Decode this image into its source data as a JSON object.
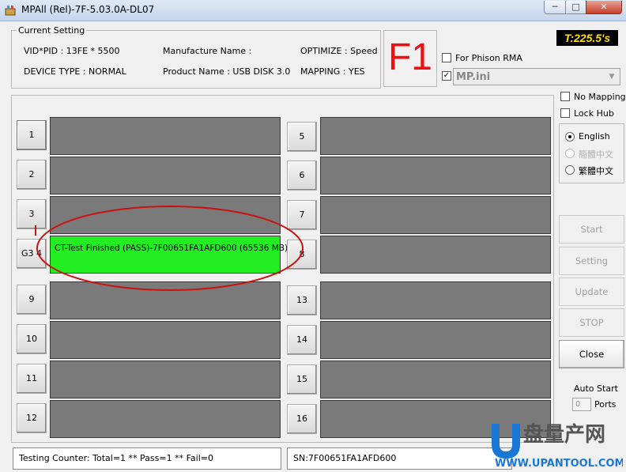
{
  "window": {
    "title": "MPAll (Rel)-7F-5.03.0A-DL07",
    "min_glyph": "─",
    "max_glyph": "□",
    "close_glyph": "✕"
  },
  "current_setting": {
    "legend": "Current Setting",
    "vid_pid": "VID*PID : 13FE * 5500",
    "manufacture_name": "Manufacture Name :",
    "optimize": "OPTIMIZE : Speed",
    "device_type": "DEVICE TYPE : NORMAL",
    "product_name": "Product Name : USB DISK 3.0",
    "mapping": "MAPPING : YES"
  },
  "f1_label": "F1",
  "timer": "T:225.5's",
  "for_phison_rma": {
    "label": "For Phison RMA",
    "checked": false
  },
  "ini": {
    "checked": true,
    "check_glyph": "✓",
    "value": "MP.ini",
    "arrow_glyph": "▼"
  },
  "options": {
    "no_mapping": {
      "label": "No Mapping",
      "checked": false
    },
    "lock_hub": {
      "label": "Lock Hub",
      "checked": false
    }
  },
  "languages": [
    {
      "label": "English",
      "selected": true,
      "enabled": true
    },
    {
      "label": "簡體中文",
      "selected": false,
      "enabled": false
    },
    {
      "label": "繁體中文",
      "selected": false,
      "enabled": true
    }
  ],
  "ports_left": [
    {
      "label": "1",
      "status": ""
    },
    {
      "label": "2",
      "status": ""
    },
    {
      "label": "3",
      "status": ""
    },
    {
      "label": "G3 4",
      "status": "CT-Test Finished (PASS)-7F00651FA1AFD600 (65536 MB)",
      "pass": true
    },
    {
      "label": "9",
      "status": ""
    },
    {
      "label": "10",
      "status": ""
    },
    {
      "label": "11",
      "status": ""
    },
    {
      "label": "12",
      "status": ""
    }
  ],
  "ports_right": [
    {
      "label": "5",
      "status": ""
    },
    {
      "label": "6",
      "status": ""
    },
    {
      "label": "7",
      "status": ""
    },
    {
      "label": "8",
      "status": ""
    },
    {
      "label": "13",
      "status": ""
    },
    {
      "label": "14",
      "status": ""
    },
    {
      "label": "15",
      "status": ""
    },
    {
      "label": "16",
      "status": ""
    }
  ],
  "buttons": {
    "start": "Start",
    "setting": "Setting",
    "update": "Update",
    "stop": "STOP",
    "close": "Close"
  },
  "auto_start": {
    "label": "Auto Start",
    "value": "0",
    "ports_label": "Ports"
  },
  "status": {
    "counter": "Testing Counter: Total=1 ** Pass=1 ** Fail=0",
    "sn": "SN:7F00651FA1AFD600"
  },
  "watermark": {
    "brand": "U盘量产网",
    "url": "WWW.UPANTOOL.COM",
    "color_blue": "#1a78d4",
    "color_gray": "#555555"
  },
  "colors": {
    "pass_green": "#22ee22",
    "slot_gray": "#7a7a7a",
    "annotation_red": "#cc1111",
    "f1_red": "#ee1111",
    "timer_yellow": "#ffe000"
  }
}
